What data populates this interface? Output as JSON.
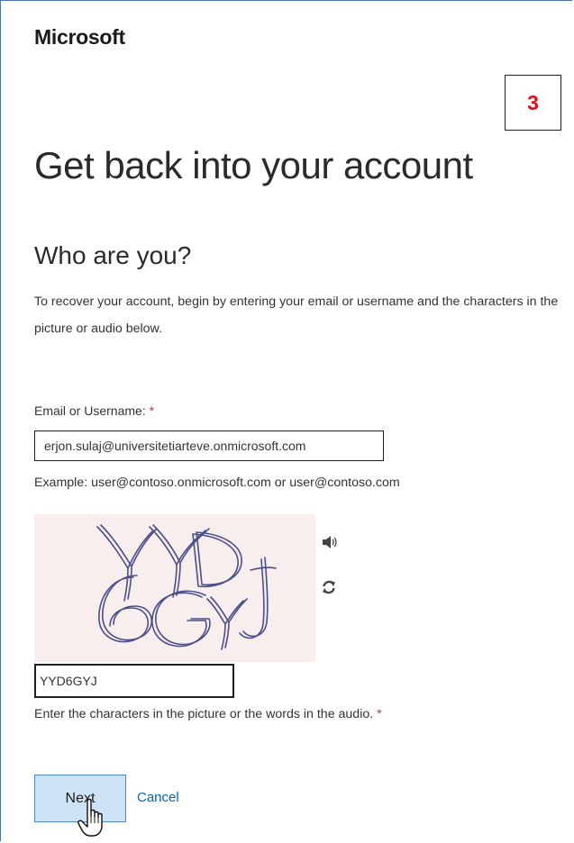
{
  "brand": {
    "name": "Microsoft"
  },
  "step_badge": "3",
  "page": {
    "title": "Get back into your account",
    "subtitle": "Who are you?",
    "description": "To recover your account, begin by entering your email or username and the characters in the picture or audio below."
  },
  "email_field": {
    "label": "Email or Username:",
    "required_mark": "*",
    "value": "erjon.sulaj@universitetiarteve.onmicrosoft.com",
    "example": "Example: user@contoso.onmicrosoft.com or user@contoso.com"
  },
  "captcha": {
    "image_text": "YYD6GYJ",
    "audio_icon": "speaker-icon",
    "refresh_icon": "refresh-icon",
    "input_value": "YYD6GYJ",
    "help_text": "Enter the characters in the picture or the words in the audio.",
    "required_mark": "*"
  },
  "actions": {
    "next_label": "Next",
    "cancel_label": "Cancel"
  },
  "colors": {
    "accent": "#0067b8",
    "button_bg": "#cde3f6",
    "required": "#d13438",
    "badge_text": "#e0101a"
  }
}
